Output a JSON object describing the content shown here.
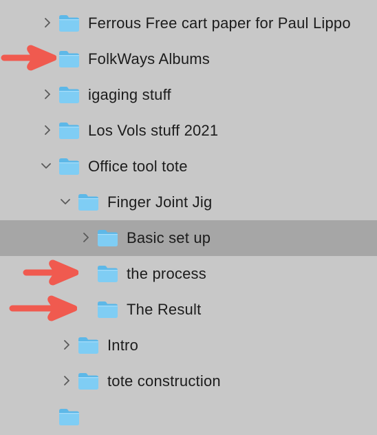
{
  "items": [
    {
      "label": "Ferrous Free cart paper for Paul Lippo",
      "depth": 0,
      "chevron": "right",
      "selected": false
    },
    {
      "label": "FolkWays Albums",
      "depth": 0,
      "chevron": "none",
      "selected": false
    },
    {
      "label": "igaging stuff",
      "depth": 0,
      "chevron": "right",
      "selected": false
    },
    {
      "label": "Los Vols stuff 2021",
      "depth": 0,
      "chevron": "right",
      "selected": false
    },
    {
      "label": "Office tool tote",
      "depth": 0,
      "chevron": "down",
      "selected": false
    },
    {
      "label": "Finger Joint Jig",
      "depth": 1,
      "chevron": "down",
      "selected": false
    },
    {
      "label": "Basic set up",
      "depth": 2,
      "chevron": "right",
      "selected": true
    },
    {
      "label": "the process",
      "depth": 2,
      "chevron": "none",
      "selected": false
    },
    {
      "label": "The Result",
      "depth": 2,
      "chevron": "none",
      "selected": false
    },
    {
      "label": "Intro",
      "depth": 1,
      "chevron": "right",
      "selected": false
    },
    {
      "label": "tote construction",
      "depth": 1,
      "chevron": "right",
      "selected": false
    },
    {
      "label": "",
      "depth": 0,
      "chevron": "none",
      "selected": false
    }
  ],
  "colors": {
    "background": "#c8c8c8",
    "selected_row": "#a6a6a6",
    "folder_body": "#7fcdf4",
    "folder_tab": "#5db8e8",
    "annotation_arrow": "#f05a4f"
  }
}
